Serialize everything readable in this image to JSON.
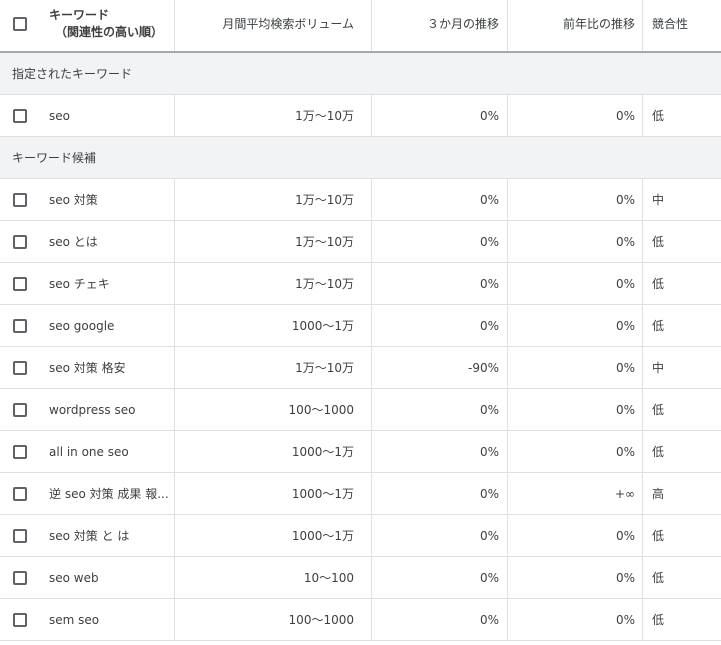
{
  "header": {
    "keyword_line1": "キーワード",
    "keyword_line2": "（関連性の高い順）",
    "monthly_volume": "月間平均検索ボリューム",
    "three_month_change": "３か月の推移",
    "yoy_change": "前年比の推移",
    "competition": "競合性"
  },
  "sections": {
    "specified": "指定されたキーワード",
    "candidates": "キーワード候補"
  },
  "specified_rows": [
    {
      "keyword": "seo",
      "volume": "1万～10万",
      "three_month": "0%",
      "yoy": "0%",
      "competition": "低"
    }
  ],
  "candidate_rows": [
    {
      "keyword": "seo 対策",
      "volume": "1万～10万",
      "three_month": "0%",
      "yoy": "0%",
      "competition": "中"
    },
    {
      "keyword": "seo とは",
      "volume": "1万～10万",
      "three_month": "0%",
      "yoy": "0%",
      "competition": "低"
    },
    {
      "keyword": "seo チェキ",
      "volume": "1万～10万",
      "three_month": "0%",
      "yoy": "0%",
      "competition": "低"
    },
    {
      "keyword": "seo google",
      "volume": "1000～1万",
      "three_month": "0%",
      "yoy": "0%",
      "competition": "低"
    },
    {
      "keyword": "seo 対策 格安",
      "volume": "1万～10万",
      "three_month": "-90%",
      "yoy": "0%",
      "competition": "中"
    },
    {
      "keyword": "wordpress seo",
      "volume": "100～1000",
      "three_month": "0%",
      "yoy": "0%",
      "competition": "低"
    },
    {
      "keyword": "all in one seo",
      "volume": "1000～1万",
      "three_month": "0%",
      "yoy": "0%",
      "competition": "低"
    },
    {
      "keyword": "逆 seo 対策 成果 報...",
      "volume": "1000～1万",
      "three_month": "0%",
      "yoy": "+∞",
      "competition": "高"
    },
    {
      "keyword": "seo 対策 と は",
      "volume": "1000～1万",
      "three_month": "0%",
      "yoy": "0%",
      "competition": "低"
    },
    {
      "keyword": "seo web",
      "volume": "10～100",
      "three_month": "0%",
      "yoy": "0%",
      "competition": "低"
    },
    {
      "keyword": "sem seo",
      "volume": "100～1000",
      "three_month": "0%",
      "yoy": "0%",
      "competition": "低"
    }
  ]
}
